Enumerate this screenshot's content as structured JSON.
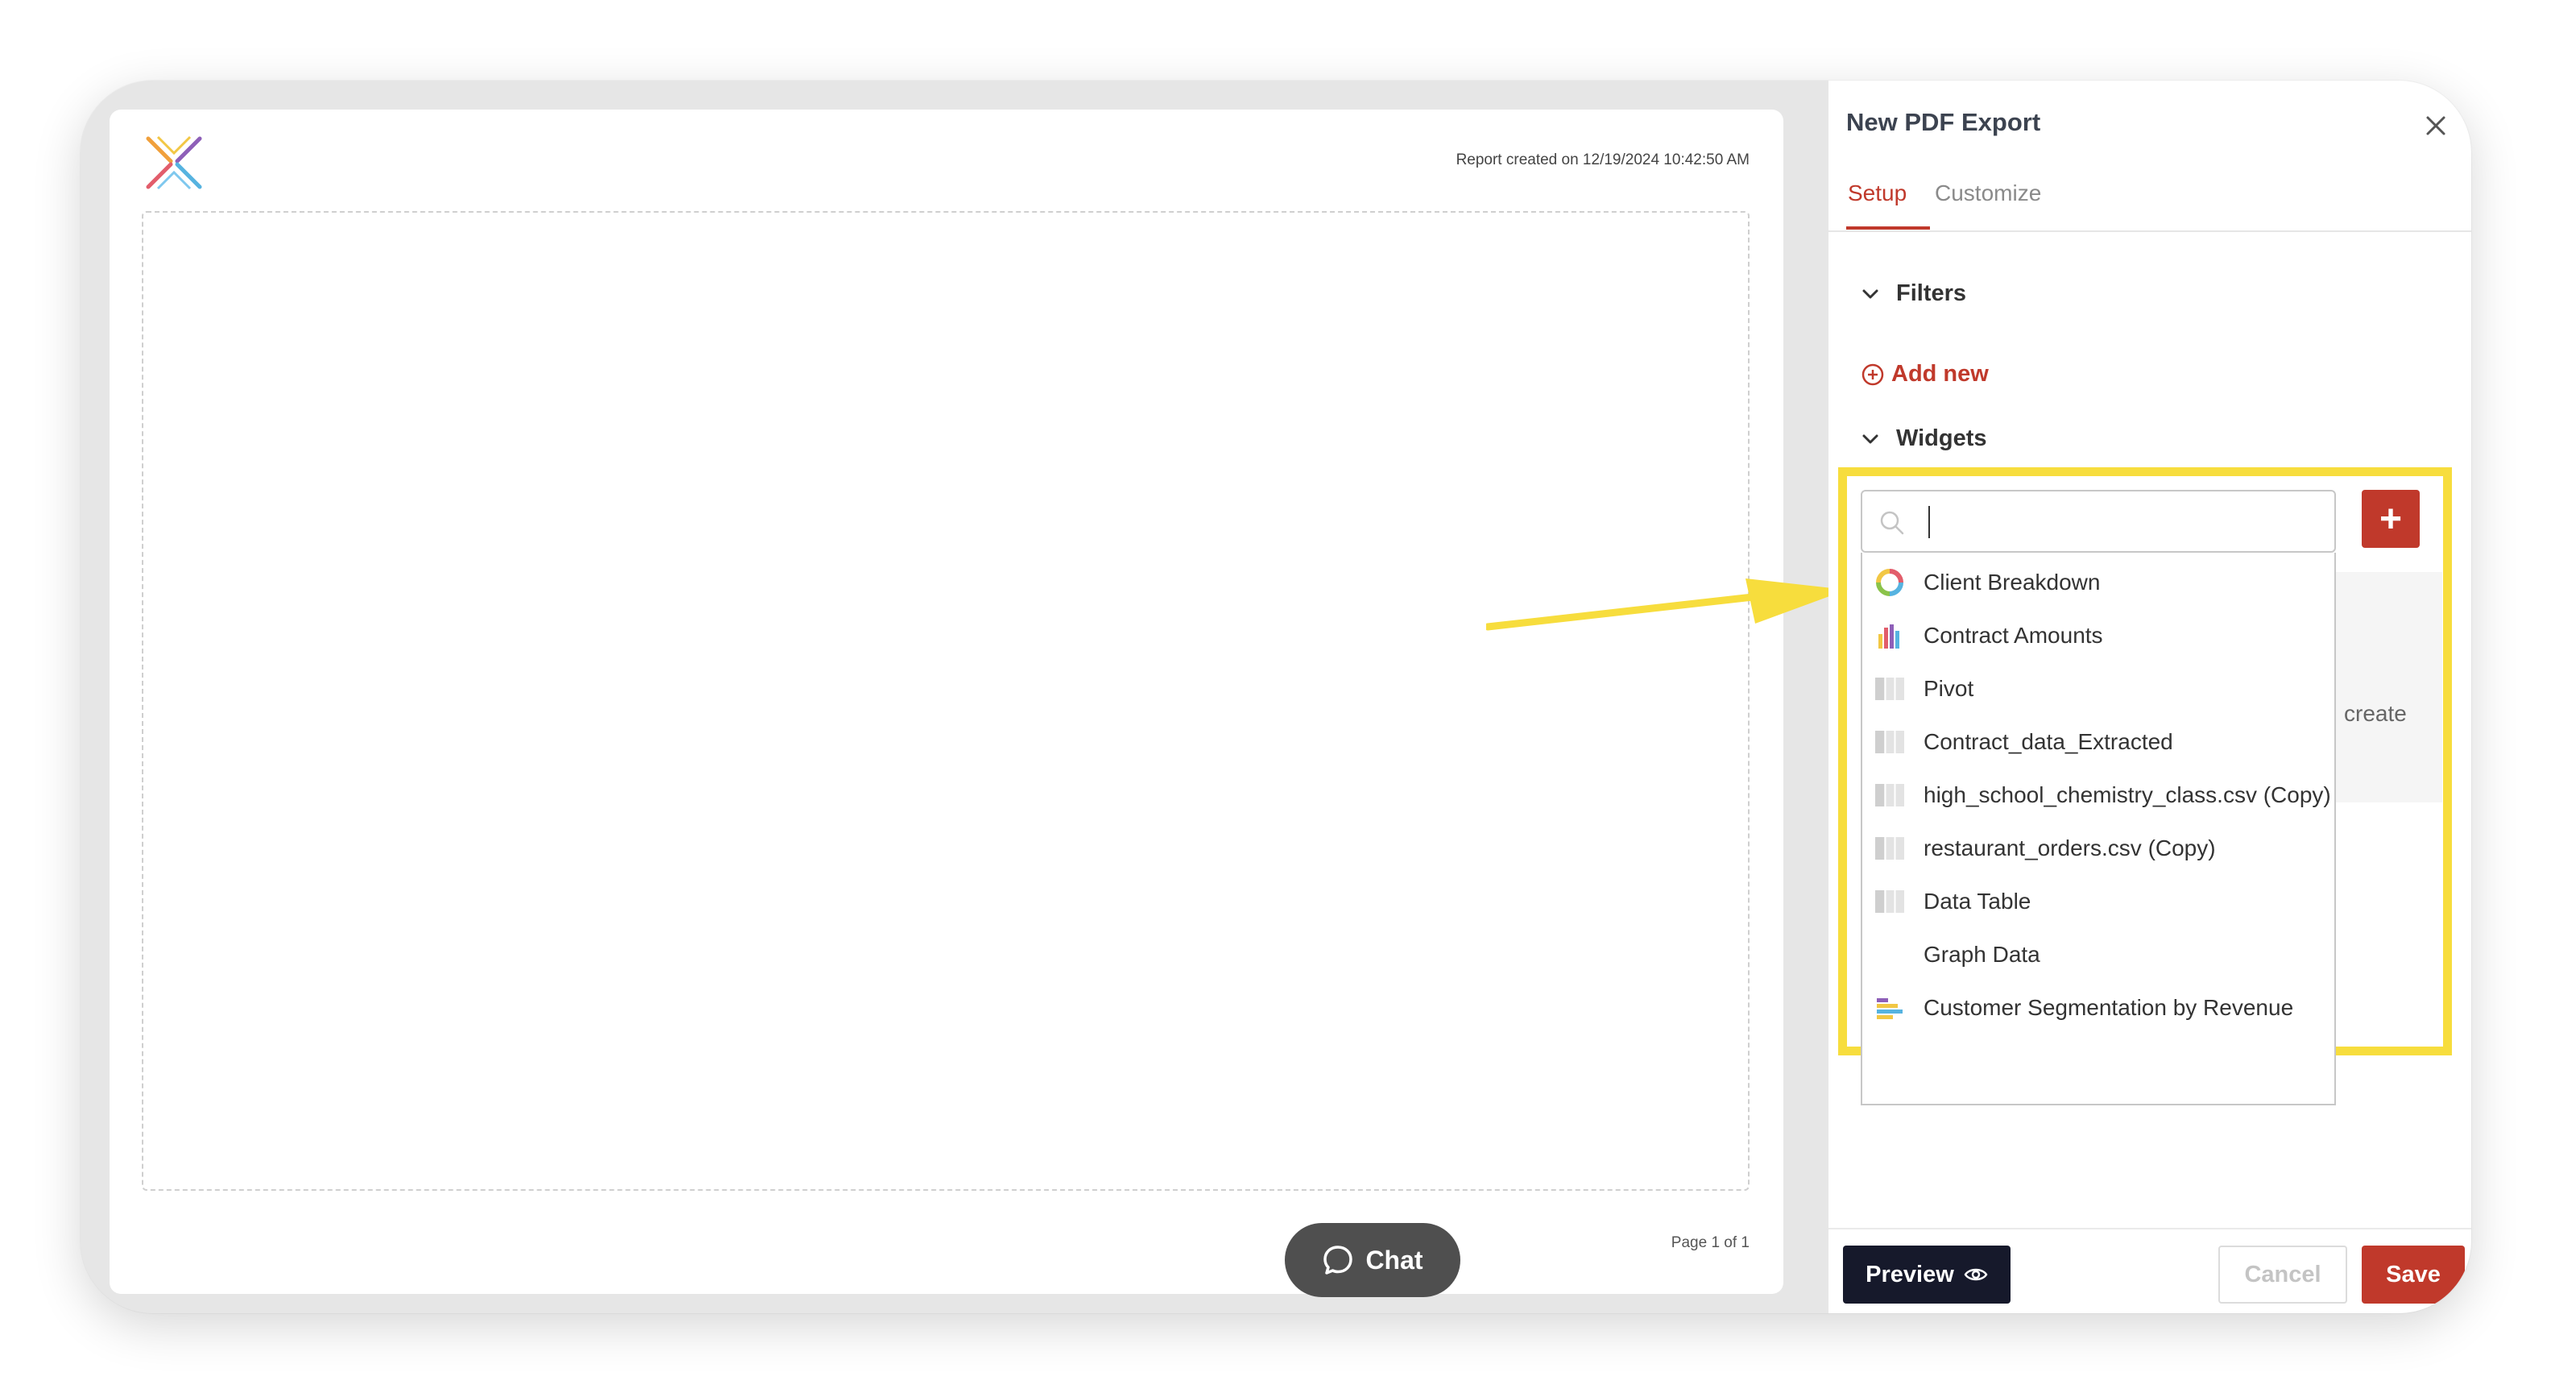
{
  "report": {
    "created_text": "Report created on 12/19/2024 10:42:50 AM",
    "page_number": "Page 1 of 1"
  },
  "chat": {
    "label": "Chat",
    "icon": "chat-bubble-icon"
  },
  "panel": {
    "title": "New PDF Export",
    "tabs": [
      {
        "label": "Setup",
        "active": true
      },
      {
        "label": "Customize",
        "active": false
      }
    ],
    "filters": {
      "heading": "Filters",
      "add_new_label": "Add new"
    },
    "widgets": {
      "heading": "Widgets",
      "search": {
        "value": "",
        "placeholder": ""
      },
      "partial_text": "create",
      "items": [
        {
          "label": "Client Breakdown",
          "icon": "donut-chart-icon"
        },
        {
          "label": "Contract Amounts",
          "icon": "bar-chart-icon"
        },
        {
          "label": "Pivot",
          "icon": "table-icon"
        },
        {
          "label": "Contract_data_Extracted",
          "icon": "table-icon"
        },
        {
          "label": "high_school_chemistry_class.csv (Copy)",
          "icon": "table-icon"
        },
        {
          "label": "restaurant_orders.csv (Copy)",
          "icon": "table-icon"
        },
        {
          "label": "Data Table",
          "icon": "table-icon"
        },
        {
          "label": "Graph Data",
          "icon": ""
        },
        {
          "label": "Customer Segmentation by Revenue",
          "icon": "horizontal-bar-chart-icon"
        }
      ]
    },
    "buttons": {
      "preview": "Preview",
      "cancel": "Cancel",
      "save": "Save"
    }
  },
  "colors": {
    "accent": "#c0392b",
    "highlight": "#f7dd3d",
    "dark_button": "#16192b"
  }
}
